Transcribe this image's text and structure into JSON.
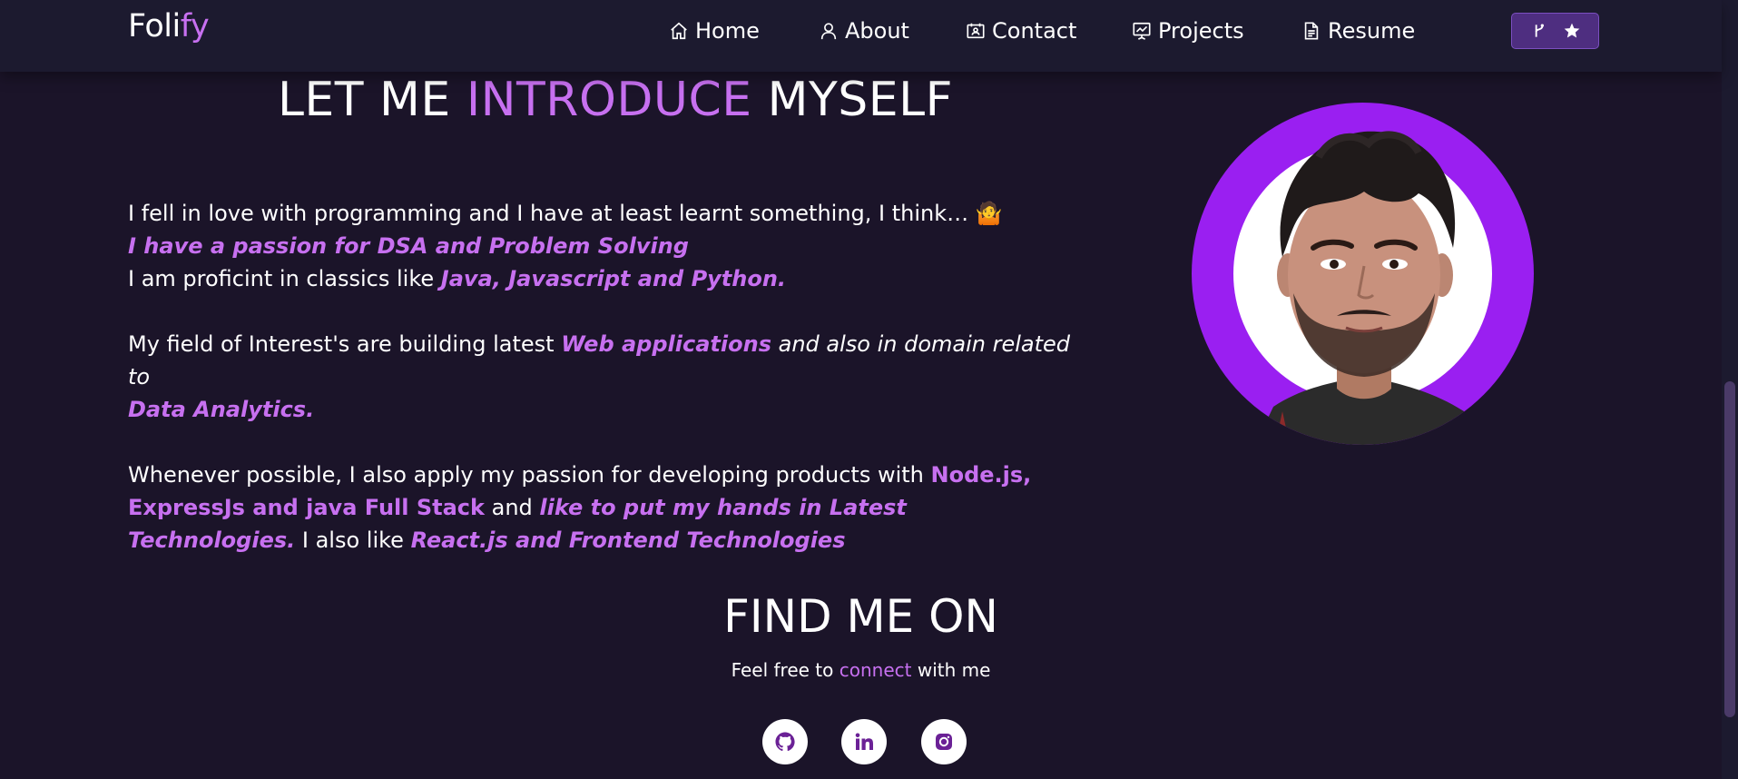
{
  "brand": {
    "part1": "Foli",
    "part2": "fy"
  },
  "nav": {
    "home": "Home",
    "about": "About",
    "contact": "Contact",
    "projects": "Projects",
    "resume": "Resume"
  },
  "intro": {
    "title_pre": "LET ME ",
    "title_accent": "INTRODUCE",
    "title_post": " MYSELF",
    "p1_line1": "I fell in love with programming and I have at least learnt something, I think… ",
    "p1_emoji": "🤷",
    "p1_line2": "I have a passion for DSA and Problem Solving",
    "p1_line3_pre": "I am proficint in classics like ",
    "p1_line3_hl": "Java, Javascript and Python.",
    "p2_pre": "My field of Interest's are building latest ",
    "p2_hl1": "Web applications",
    "p2_mid": " and also in domain related to ",
    "p2_hl2": "Data Analytics.",
    "p3_pre": "Whenever possible, I also apply my passion for developing products with ",
    "p3_hl1": "Node.js, ExpressJs and java Full Stack",
    "p3_and": " and ",
    "p3_hl2": "like to put my hands in Latest Technologies.",
    "p3_also": "  I also like ",
    "p3_hl3": "React.js and Frontend Technologies"
  },
  "find": {
    "title": "FIND ME ON",
    "sub_pre": "Feel free to ",
    "sub_accent": "connect",
    "sub_post": " with me"
  },
  "colors": {
    "accent": "#c770f0",
    "background": "#1b1429",
    "navbar": "#1c1a2f",
    "avatar_ring": "#9a1ff1",
    "github_button": "#4e2e80"
  },
  "icons": {
    "home": "home-icon",
    "about": "user-icon",
    "contact": "contact-card-icon",
    "projects": "presentation-chart-icon",
    "resume": "document-icon",
    "fork": "git-fork-icon",
    "star": "star-icon",
    "github": "github-icon",
    "linkedin": "linkedin-icon",
    "instagram": "instagram-icon"
  }
}
